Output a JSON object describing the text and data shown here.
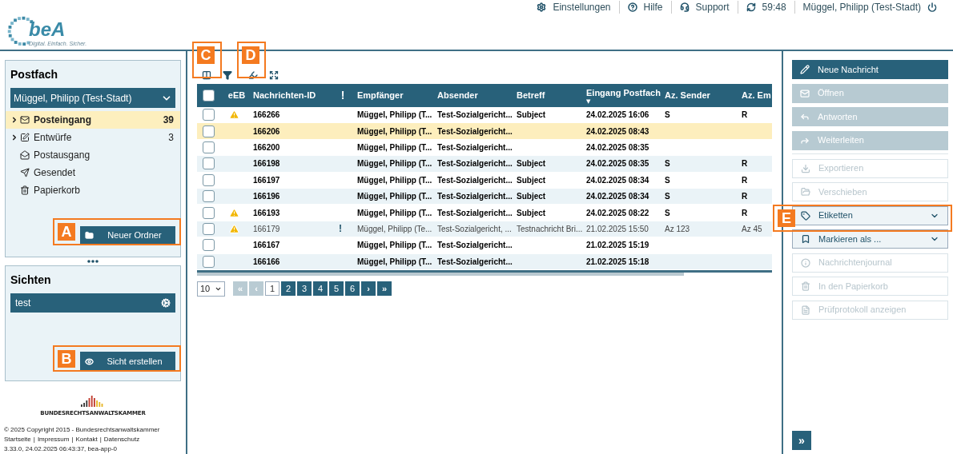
{
  "logo": {
    "name": "beA",
    "tagline": "Digital. Einfach. Sicher."
  },
  "top_nav": [
    "Einstellungen",
    "Hilfe",
    "Support",
    "59:48",
    "Müggel, Philipp (Test-Stadt)"
  ],
  "postfach": {
    "title": "Postfach",
    "account": "Müggel, Philipp (Test-Stadt)",
    "items": [
      {
        "label": "Posteingang",
        "count": "39",
        "expandable": true,
        "selected": true
      },
      {
        "label": "Entwürfe",
        "count": "3",
        "expandable": true,
        "selected": false
      },
      {
        "label": "Postausgang",
        "expandable": false,
        "selected": false
      },
      {
        "label": "Gesendet",
        "expandable": false,
        "selected": false
      },
      {
        "label": "Papierkorb",
        "expandable": false,
        "selected": false
      }
    ],
    "button": "Neuer Ordner"
  },
  "sichten": {
    "title": "Sichten",
    "items": [
      "test"
    ],
    "button": "Sicht erstellen"
  },
  "footer": {
    "org": "BUNDESRECHTSANWALTSKAMMER",
    "copyright": "© 2025 Copyright 2015 - Bundesrechtsanwaltskammer",
    "links": [
      "Startseite",
      "Impressum",
      "Kontakt",
      "Datenschutz"
    ],
    "separator": "|",
    "version": "3.33.0, 24.02.2025 06:43:37, bea-app-0"
  },
  "table": {
    "select_all_checked": false,
    "columns": [
      {
        "label": "eEB"
      },
      {
        "label": "Nachrichten-ID"
      },
      {
        "label": "!"
      },
      {
        "label": "Empfänger"
      },
      {
        "label": "Absender"
      },
      {
        "label": "Betreff"
      },
      {
        "label": "Eingang Postfach",
        "sort_arrow": "▼"
      },
      {
        "label": "Az. Sender"
      },
      {
        "label": "Az. Em"
      }
    ],
    "rows": [
      {
        "warning": true,
        "id": "166266",
        "recipient": "Müggel, Philipp (T...",
        "sender": "Test-Sozialgericht...",
        "subject": "Subject",
        "received": "24.02.2025 16:06",
        "az_sender": "S",
        "az_recipient": "R",
        "unread": true,
        "selected": false
      },
      {
        "warning": false,
        "id": "166206",
        "recipient": "Müggel, Philipp (T...",
        "sender": "Test-Sozialgericht...",
        "received": "24.02.2025 08:43",
        "unread": true,
        "selected": true
      },
      {
        "warning": false,
        "id": "166200",
        "recipient": "Müggel, Philipp (T...",
        "sender": "Test-Sozialgericht...",
        "received": "24.02.2025 08:35",
        "unread": true,
        "selected": false
      },
      {
        "warning": false,
        "id": "166198",
        "recipient": "Müggel, Philipp (T...",
        "sender": "Test-Sozialgericht...",
        "subject": "Subject",
        "received": "24.02.2025 08:35",
        "az_sender": "S",
        "az_recipient": "R",
        "unread": true,
        "selected": false
      },
      {
        "warning": false,
        "id": "166197",
        "recipient": "Müggel, Philipp (T...",
        "sender": "Test-Sozialgericht...",
        "subject": "Subject",
        "received": "24.02.2025 08:34",
        "az_sender": "S",
        "az_recipient": "R",
        "unread": true,
        "selected": false
      },
      {
        "warning": false,
        "id": "166196",
        "recipient": "Müggel, Philipp (T...",
        "sender": "Test-Sozialgericht...",
        "subject": "Subject",
        "received": "24.02.2025 08:34",
        "az_sender": "S",
        "az_recipient": "R",
        "unread": true,
        "selected": false
      },
      {
        "warning": true,
        "id": "166193",
        "recipient": "Müggel, Philipp (T...",
        "sender": "Test-Sozialgericht...",
        "subject": "Subject",
        "received": "24.02.2025 08:22",
        "az_sender": "S",
        "az_recipient": "R",
        "unread": true,
        "selected": false
      },
      {
        "warning": true,
        "id": "166179",
        "priority": "!",
        "recipient": "Müggel, Philipp (Te...",
        "sender": "Test-Sozialgericht, ...",
        "subject": "Testnachricht Bri...",
        "received": "21.02.2025 15:50",
        "az_sender": "Az 123",
        "az_recipient": "Az 45",
        "unread": false,
        "selected": false
      },
      {
        "warning": false,
        "id": "166167",
        "recipient": "Müggel, Philipp (T...",
        "sender": "Test-Sozialgericht...",
        "received": "21.02.2025 15:19",
        "unread": true,
        "selected": false
      },
      {
        "warning": false,
        "id": "166166",
        "recipient": "Müggel, Philipp (T...",
        "sender": "Test-Sozialgericht...",
        "received": "21.02.2025 15:18",
        "unread": true,
        "selected": false
      }
    ]
  },
  "pagination": {
    "page_size": "10",
    "first": "«",
    "prev": "‹",
    "next": "›",
    "last": "»",
    "pages": [
      {
        "label": "1",
        "selected": true
      },
      {
        "label": "2",
        "selected": false
      },
      {
        "label": "3",
        "selected": false
      },
      {
        "label": "4",
        "selected": false
      },
      {
        "label": "5",
        "selected": false
      },
      {
        "label": "6",
        "selected": false
      }
    ],
    "first_disabled": true
  },
  "actions": [
    {
      "kind": "primary",
      "label": "Neue Nachricht",
      "disabled": false
    },
    {
      "kind": "filled",
      "label": "Öffnen",
      "disabled": true
    },
    {
      "kind": "filled",
      "label": "Antworten",
      "disabled": true
    },
    {
      "kind": "filled",
      "label": "Weiterleiten",
      "disabled": true
    },
    {
      "kind": "outline",
      "label": "Exportieren",
      "disabled": true
    },
    {
      "kind": "outline",
      "label": "Verschieben",
      "disabled": true
    },
    {
      "kind": "dropdown",
      "label": "Etiketten",
      "disabled": false
    },
    {
      "kind": "dropdown",
      "label": "Markieren als ...",
      "disabled": false
    },
    {
      "kind": "outline",
      "label": "Nachrichtenjournal",
      "disabled": true
    },
    {
      "kind": "outline",
      "label": "In den Papierkorb",
      "disabled": true
    },
    {
      "kind": "outline",
      "label": "Prüfprotokoll anzeigen",
      "disabled": true
    }
  ],
  "collapse_button": "»",
  "callouts": [
    "A",
    "B",
    "C",
    "D",
    "E"
  ]
}
